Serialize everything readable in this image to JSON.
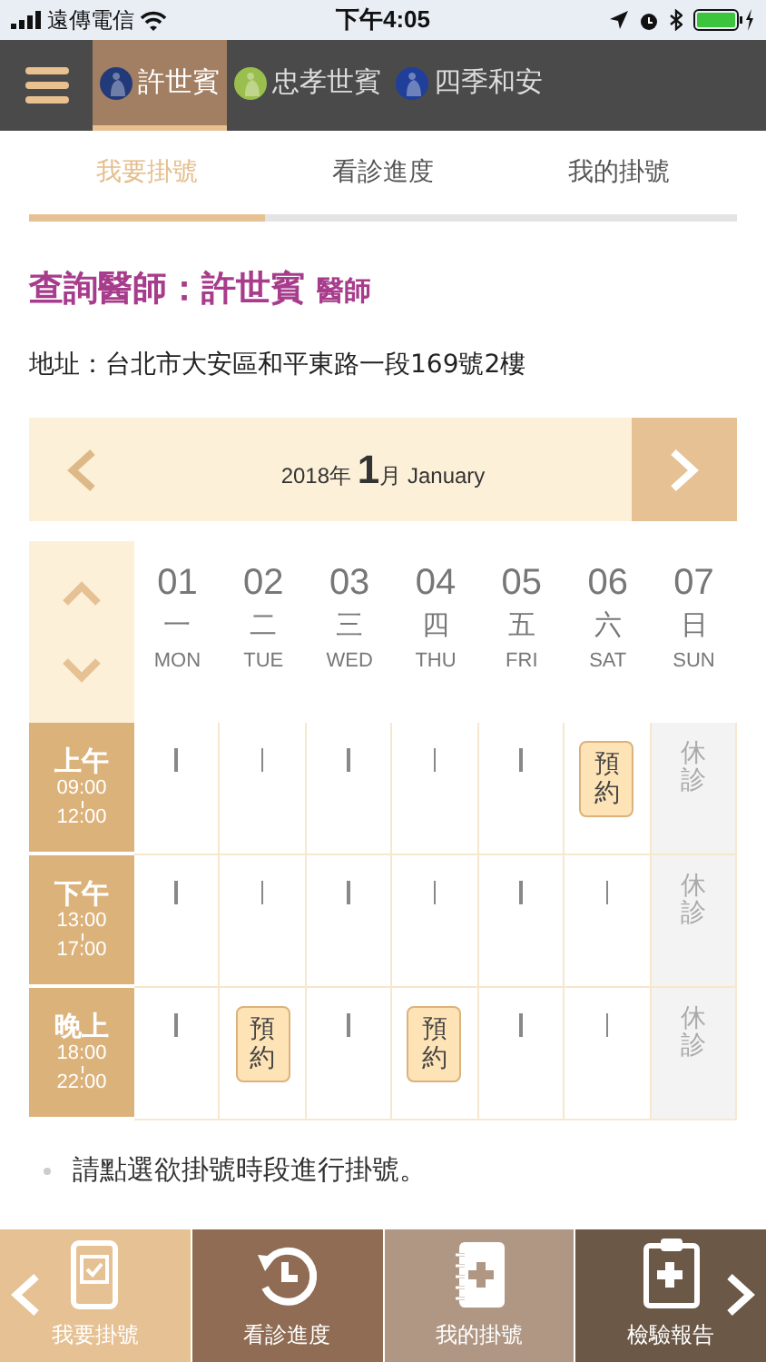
{
  "status_bar": {
    "carrier": "遠傳電信",
    "time": "下午4:05"
  },
  "doctors": [
    {
      "name": "許世賓",
      "selected": true,
      "color": "#233a7a"
    },
    {
      "name": "忠孝世賓",
      "selected": false,
      "color": "#9bbf4e"
    },
    {
      "name": "四季和安",
      "selected": false,
      "color": "#1f3f9a"
    }
  ],
  "tabs": [
    {
      "label": "我要掛號",
      "selected": true
    },
    {
      "label": "看診進度",
      "selected": false
    },
    {
      "label": "我的掛號",
      "selected": false
    }
  ],
  "title": {
    "label": "查詢醫師：許世賓",
    "suffix": "醫師"
  },
  "address": "地址：台北市大安區和平東路一段169號2樓",
  "month": {
    "year": "2018年",
    "month": "1",
    "month_unit": "月",
    "month_name": "January"
  },
  "days": [
    {
      "date": "01",
      "cn": "一",
      "en": "MON"
    },
    {
      "date": "02",
      "cn": "二",
      "en": "TUE"
    },
    {
      "date": "03",
      "cn": "三",
      "en": "WED"
    },
    {
      "date": "04",
      "cn": "四",
      "en": "THU"
    },
    {
      "date": "05",
      "cn": "五",
      "en": "FRI"
    },
    {
      "date": "06",
      "cn": "六",
      "en": "SAT"
    },
    {
      "date": "07",
      "cn": "日",
      "en": "SUN"
    }
  ],
  "sessions": [
    {
      "name": "上午",
      "start": "09:00",
      "end": "12:00",
      "cells": [
        {
          "kind": "open"
        },
        {
          "kind": "open"
        },
        {
          "kind": "open"
        },
        {
          "kind": "open"
        },
        {
          "kind": "open"
        },
        {
          "kind": "book",
          "label": "預約"
        },
        {
          "kind": "closed",
          "label": "休診"
        }
      ]
    },
    {
      "name": "下午",
      "start": "13:00",
      "end": "17:00",
      "cells": [
        {
          "kind": "open"
        },
        {
          "kind": "open"
        },
        {
          "kind": "open"
        },
        {
          "kind": "open"
        },
        {
          "kind": "open"
        },
        {
          "kind": "open"
        },
        {
          "kind": "closed",
          "label": "休診"
        }
      ]
    },
    {
      "name": "晚上",
      "start": "18:00",
      "end": "22:00",
      "cells": [
        {
          "kind": "open"
        },
        {
          "kind": "book",
          "label": "預約"
        },
        {
          "kind": "open"
        },
        {
          "kind": "book",
          "label": "預約"
        },
        {
          "kind": "open"
        },
        {
          "kind": "open"
        },
        {
          "kind": "closed",
          "label": "休診"
        }
      ]
    }
  ],
  "notes": [
    "請點選欲掛號時段進行掛號。"
  ],
  "bottom_nav": [
    {
      "label": "我要掛號",
      "color": "#e6c193",
      "kind": "phone"
    },
    {
      "label": "看診進度",
      "color": "#8f6c53",
      "kind": "history"
    },
    {
      "label": "我的掛號",
      "color": "#b09784",
      "kind": "notebook"
    },
    {
      "label": "檢驗報告",
      "color": "#6b5847",
      "kind": "clipboard"
    }
  ]
}
